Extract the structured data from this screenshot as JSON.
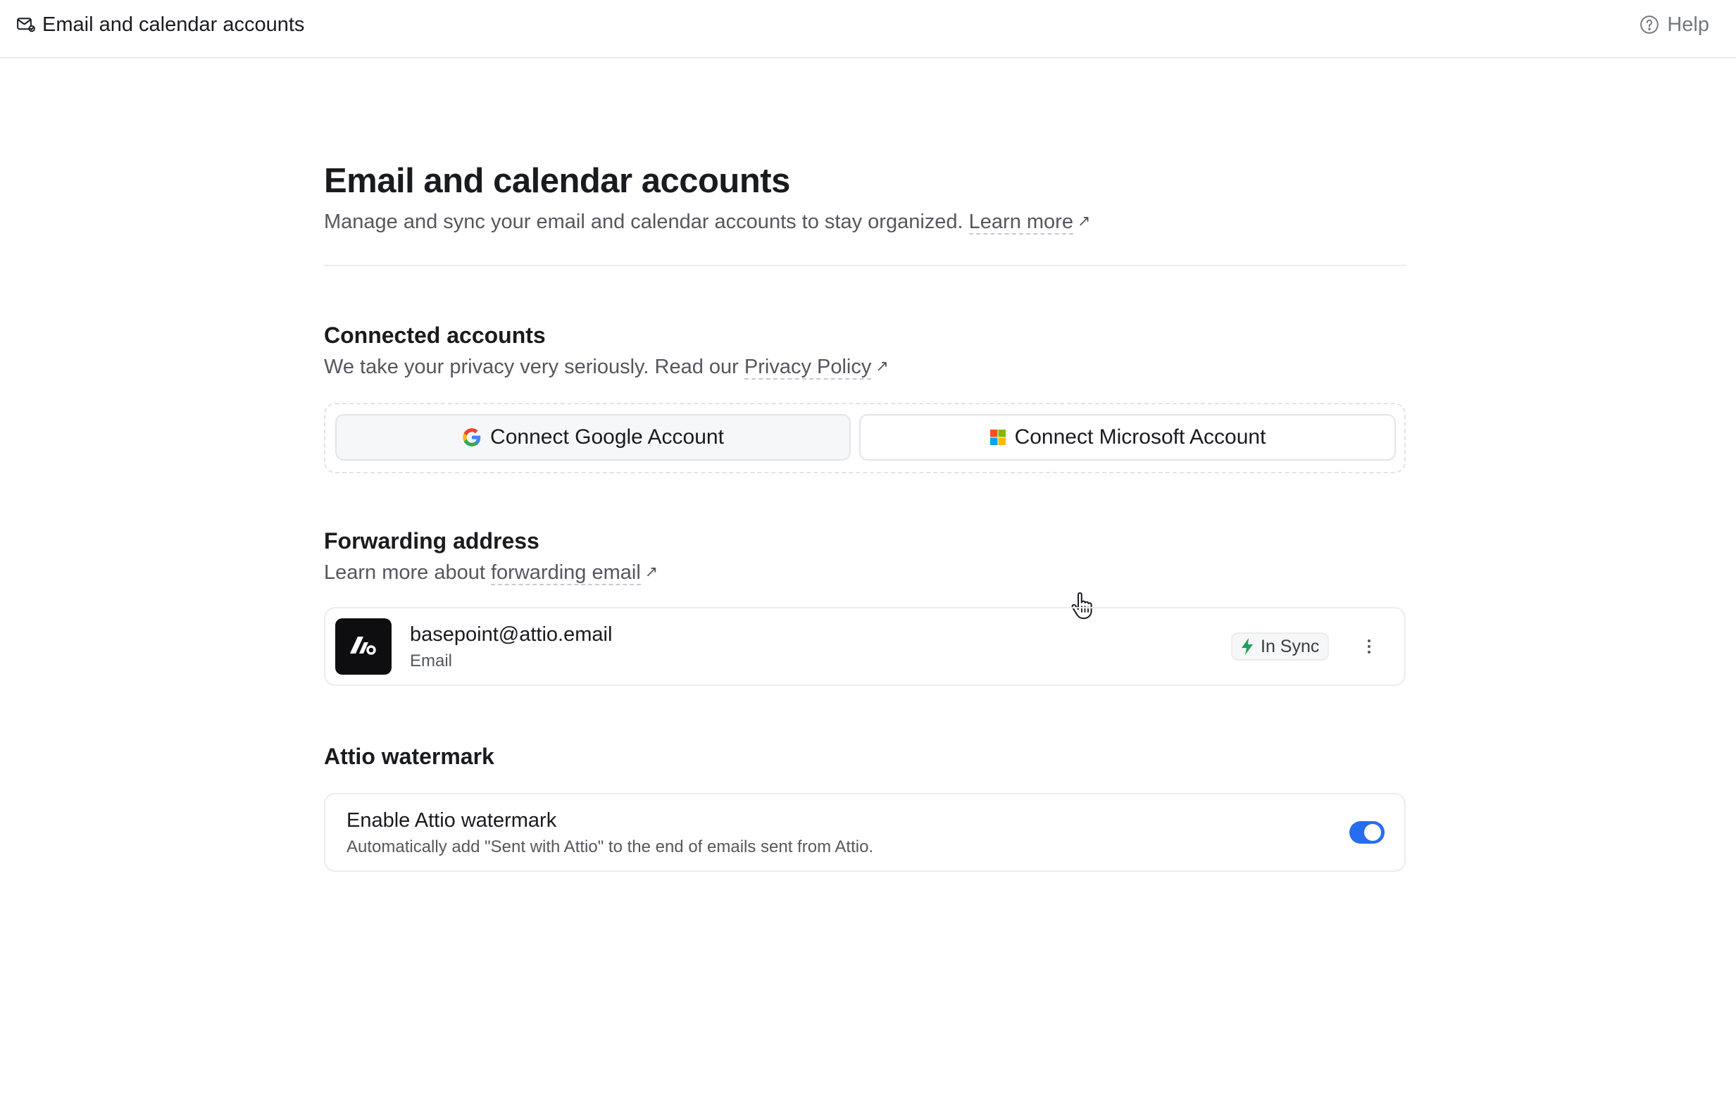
{
  "topbar": {
    "title": "Email and calendar accounts",
    "title_icon": "mail-settings-icon",
    "help_label": "Help",
    "help_icon": "question-circle-icon"
  },
  "header": {
    "title": "Email and calendar accounts",
    "subtitle": "Manage and sync your email and calendar accounts to stay organized.",
    "learn_more": "Learn more",
    "external_icon": "↗"
  },
  "connected": {
    "title": "Connected accounts",
    "subtitle": "We take your privacy very seriously. Read our",
    "privacy_link": "Privacy Policy",
    "google_button": "Connect Google Account",
    "microsoft_button": "Connect Microsoft Account"
  },
  "forwarding": {
    "title": "Forwarding address",
    "subtitle": "Learn more about",
    "link": "forwarding email",
    "email": "basepoint@attio.email",
    "type": "Email",
    "status": "In Sync",
    "status_color": "#1aa35c"
  },
  "watermark": {
    "title": "Attio watermark",
    "setting_title": "Enable Attio watermark",
    "setting_desc": "Automatically add \"Sent with Attio\" to the end of emails sent from Attio.",
    "enabled": true,
    "toggle_color": "#266df0"
  }
}
